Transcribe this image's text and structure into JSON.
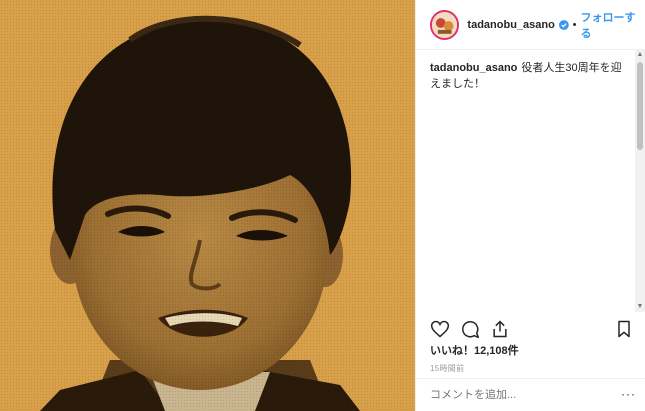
{
  "photo": {
    "description_icon": "portrait-photo"
  },
  "header": {
    "username": "tadanobu_asano",
    "verified_icon": "verified-badge-icon",
    "separator": "•",
    "follow_label": "フォローする"
  },
  "caption": {
    "username": "tadanobu_asano",
    "text": "役者人生30周年を迎えました！"
  },
  "actions": {
    "like_icon": "heart-icon",
    "comment_icon": "comment-icon",
    "share_icon": "share-icon",
    "save_icon": "bookmark-icon"
  },
  "likes_text": "いいね！12,108件",
  "timestamp": "15時間前",
  "comment": {
    "placeholder": "コメントを追加...",
    "more_label": "···"
  },
  "colors": {
    "accent": "#3897f0",
    "photo_bg": "#d8a04a",
    "verified": "#3897f0"
  }
}
